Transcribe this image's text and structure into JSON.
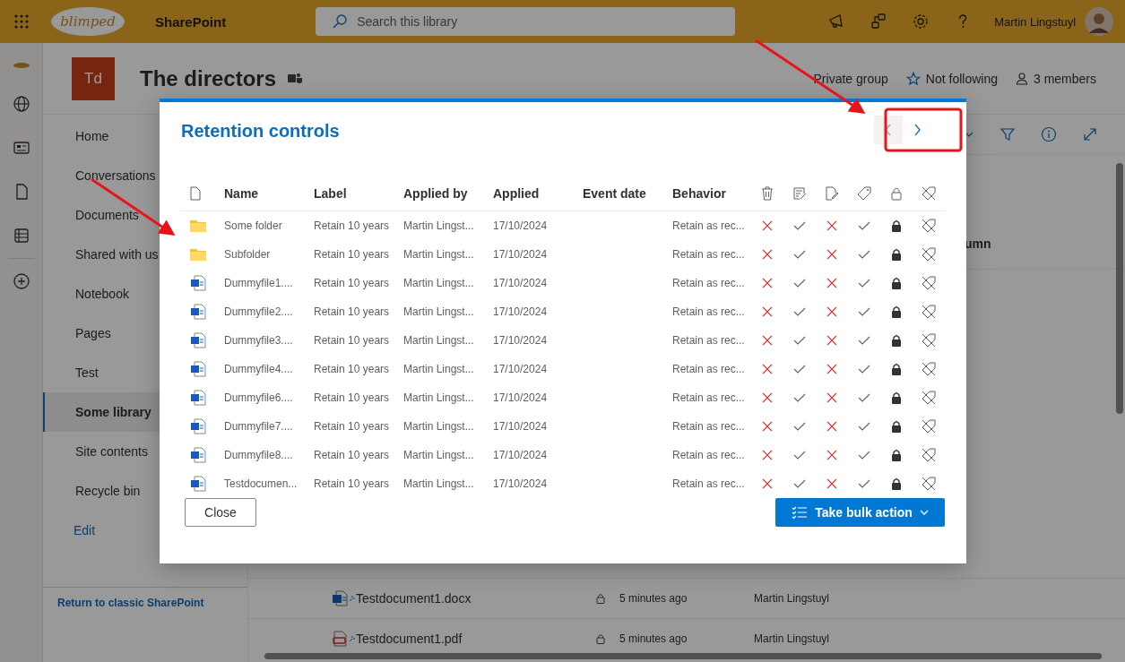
{
  "top_bar": {
    "logo_text": "blimped",
    "app_name": "SharePoint",
    "search": {
      "placeholder": "Search this library"
    },
    "user": "Martin Lingstuyl"
  },
  "site_header": {
    "logo": "Td",
    "title": "The directors",
    "privacy": "Private group",
    "follow": "Not following",
    "members": "3 members"
  },
  "nav": {
    "items": [
      {
        "label": "Home",
        "selected": false
      },
      {
        "label": "Conversations",
        "selected": false
      },
      {
        "label": "Documents",
        "selected": false
      },
      {
        "label": "Shared with us",
        "selected": false
      },
      {
        "label": "Notebook",
        "selected": false
      },
      {
        "label": "Pages",
        "selected": false
      },
      {
        "label": "Test",
        "selected": false
      },
      {
        "label": "Some library",
        "selected": true
      },
      {
        "label": "Site contents",
        "selected": false
      },
      {
        "label": "Recycle bin",
        "selected": false
      }
    ],
    "edit": "Edit",
    "footer_link": "Return to classic SharePoint"
  },
  "library": {
    "column_fragment": "umn",
    "rows": [
      {
        "kind": "word",
        "name": "Testdocument1.docx",
        "modified": "5 minutes ago",
        "modified_by": "Martin Lingstuyl"
      },
      {
        "kind": "pdf",
        "name": "Testdocument1.pdf",
        "modified": "5 minutes ago",
        "modified_by": "Martin Lingstuyl"
      }
    ]
  },
  "dialog": {
    "title": "Retention controls",
    "nav_buttons": [
      {
        "kind": "prev",
        "disabled": true
      },
      {
        "kind": "next",
        "disabled": false
      }
    ],
    "columns": [
      "Name",
      "Label",
      "Applied by",
      "Applied",
      "Event date",
      "Behavior"
    ],
    "rows": [
      {
        "kind": "folder",
        "name": "Some folder",
        "label": "Retain 10 years",
        "applied_by": "Martin Lingst...",
        "applied": "17/10/2024",
        "behavior": "Retain as rec...",
        "delete": false,
        "edit_properties": true,
        "edit": false,
        "relabel": true,
        "locked": true
      },
      {
        "kind": "folder",
        "name": "Subfolder",
        "label": "Retain 10 years",
        "applied_by": "Martin Lingst...",
        "applied": "17/10/2024",
        "behavior": "Retain as rec...",
        "delete": false,
        "edit_properties": true,
        "edit": false,
        "relabel": true,
        "locked": true
      },
      {
        "kind": "word",
        "name": "Dummyfile1....",
        "label": "Retain 10 years",
        "applied_by": "Martin Lingst...",
        "applied": "17/10/2024",
        "behavior": "Retain as rec...",
        "delete": false,
        "edit_properties": true,
        "edit": false,
        "relabel": true,
        "locked": true
      },
      {
        "kind": "word",
        "name": "Dummyfile2....",
        "label": "Retain 10 years",
        "applied_by": "Martin Lingst...",
        "applied": "17/10/2024",
        "behavior": "Retain as rec...",
        "delete": false,
        "edit_properties": true,
        "edit": false,
        "relabel": true,
        "locked": true
      },
      {
        "kind": "word",
        "name": "Dummyfile3....",
        "label": "Retain 10 years",
        "applied_by": "Martin Lingst...",
        "applied": "17/10/2024",
        "behavior": "Retain as rec...",
        "delete": false,
        "edit_properties": true,
        "edit": false,
        "relabel": true,
        "locked": true
      },
      {
        "kind": "word",
        "name": "Dummyfile4....",
        "label": "Retain 10 years",
        "applied_by": "Martin Lingst...",
        "applied": "17/10/2024",
        "behavior": "Retain as rec...",
        "delete": false,
        "edit_properties": true,
        "edit": false,
        "relabel": true,
        "locked": true
      },
      {
        "kind": "word",
        "name": "Dummyfile6....",
        "label": "Retain 10 years",
        "applied_by": "Martin Lingst...",
        "applied": "17/10/2024",
        "behavior": "Retain as rec...",
        "delete": false,
        "edit_properties": true,
        "edit": false,
        "relabel": true,
        "locked": true
      },
      {
        "kind": "word",
        "name": "Dummyfile7....",
        "label": "Retain 10 years",
        "applied_by": "Martin Lingst...",
        "applied": "17/10/2024",
        "behavior": "Retain as rec...",
        "delete": false,
        "edit_properties": true,
        "edit": false,
        "relabel": true,
        "locked": true
      },
      {
        "kind": "word",
        "name": "Dummyfile8....",
        "label": "Retain 10 years",
        "applied_by": "Martin Lingst...",
        "applied": "17/10/2024",
        "behavior": "Retain as rec...",
        "delete": false,
        "edit_properties": true,
        "edit": false,
        "relabel": true,
        "locked": true
      },
      {
        "kind": "word",
        "name": "Testdocumen...",
        "label": "Retain 10 years",
        "applied_by": "Martin Lingst...",
        "applied": "17/10/2024",
        "behavior": "Retain as rec...",
        "delete": false,
        "edit_properties": true,
        "edit": false,
        "relabel": true,
        "locked": true
      }
    ],
    "close": "Close",
    "bulk_action": "Take bulk action"
  },
  "annotations": [
    {
      "kind": "arrow"
    },
    {
      "kind": "arrow"
    },
    {
      "kind": "box"
    }
  ]
}
